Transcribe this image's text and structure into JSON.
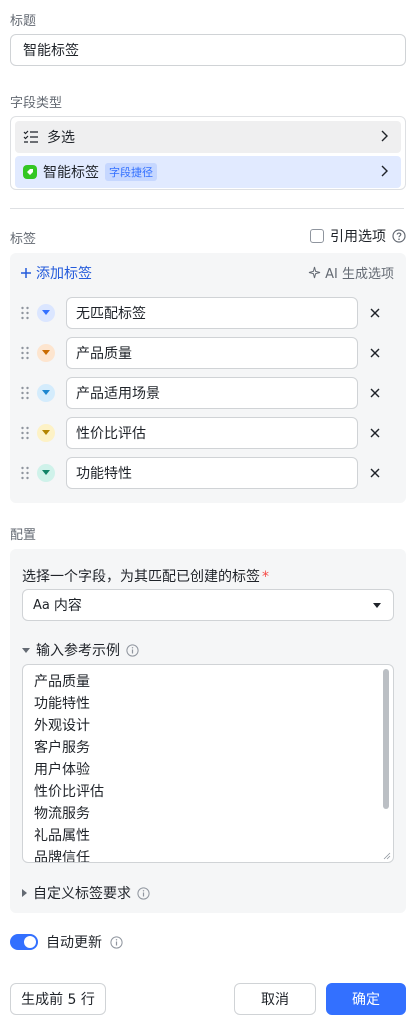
{
  "title_section": {
    "label": "标题",
    "value": "智能标签"
  },
  "field_type": {
    "label": "字段类型",
    "primary": {
      "label": "多选",
      "icon": "multi-select-icon"
    },
    "secondary": {
      "label": "智能标签",
      "badge": "字段捷径",
      "icon": "ai-tag-icon"
    }
  },
  "tags": {
    "label": "标签",
    "reference_option": "引用选项",
    "add_label": "添加标签",
    "ai_generate_label": "AI 生成选项",
    "items": [
      {
        "label": "无匹配标签",
        "color": "#dbe6ff",
        "arrow": "#3370ff"
      },
      {
        "label": "产品质量",
        "color": "#fde5cf",
        "arrow": "#c96b00"
      },
      {
        "label": "产品适用场景",
        "color": "#d4ecfc",
        "arrow": "#1d86cf"
      },
      {
        "label": "性价比评估",
        "color": "#fdf2c6",
        "arrow": "#b38500"
      },
      {
        "label": "功能特性",
        "color": "#cff2ea",
        "arrow": "#118367"
      }
    ]
  },
  "config": {
    "label": "配置",
    "question": "选择一个字段，为其匹配已创建的标签",
    "required_mark": "*",
    "selected_field_icon": "Aa",
    "selected_field": "内容",
    "examples_label": "输入参考示例",
    "examples": [
      "产品质量",
      "功能特性",
      "外观设计",
      "客户服务",
      "用户体验",
      "性价比评估",
      "物流服务",
      "礼品属性",
      "品牌信任"
    ],
    "custom_label": "自定义标签要求"
  },
  "auto_update": {
    "label": "自动更新",
    "enabled": true
  },
  "footer": {
    "generate_label": "生成前 5 行",
    "cancel_label": "取消",
    "confirm_label": "确定"
  },
  "colors": {
    "accent": "#3370ff",
    "required": "#f54a45"
  }
}
